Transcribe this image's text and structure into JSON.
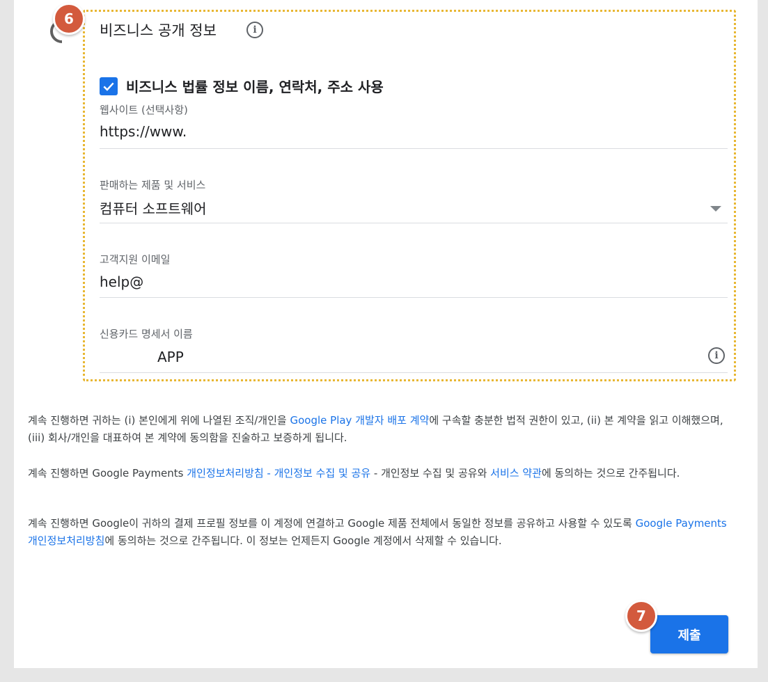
{
  "step_badges": {
    "first": "6",
    "second": "7"
  },
  "section": {
    "title": "비즈니스 공개 정보",
    "info_icon": "info-icon"
  },
  "checkbox": {
    "checked": true,
    "label": "비즈니스 법률 정보 이름, 연락처, 주소 사용"
  },
  "fields": {
    "website": {
      "label": "웹사이트 (선택사항)",
      "value": "https://www."
    },
    "products": {
      "label": "판매하는 제품 및 서비스",
      "value": "컴퓨터 소프트웨어"
    },
    "support_email": {
      "label": "고객지원 이메일",
      "value": "help@"
    },
    "card_name": {
      "label": "신용카드 명세서 이름",
      "value": "APP"
    }
  },
  "paragraphs": {
    "p1": {
      "t1": "계속 진행하면 귀하는 (i) 본인에게 위에 나열된 조직/개인을 ",
      "link1": "Google Play 개발자 배포 계약",
      "t2": "에 구속할 충분한 법적 권한이 있고, (ii) 본 계약을 읽고 이해했으며, (iii) 회사/개인을 대표하여 본 계약에 동의함을 진술하고 보증하게 됩니다."
    },
    "p2": {
      "t1": "계속 진행하면 Google Payments ",
      "link1": "개인정보처리방침 - 개인정보 수집 및 공유",
      "t2": " - 개인정보 수집 및 공유와 ",
      "link2": "서비스 약관",
      "t3": "에 동의하는 것으로 간주됩니다."
    },
    "p3": {
      "t1": "계속 진행하면 Google이 귀하의 결제 프로필 정보를 이 계정에 연결하고 Google 제품 전체에서 동일한 정보를 공유하고 사용할 수 있도록 ",
      "link1": "Google Payments 개인정보처리방침",
      "t2": "에 동의하는 것으로 간주됩니다. 이 정보는 언제든지 Google 계정에서 삭제할 수 있습니다."
    }
  },
  "submit_label": "제출",
  "colors": {
    "primary": "#1a73e8",
    "badge": "#d35a3d",
    "highlight": "#e8b733"
  }
}
